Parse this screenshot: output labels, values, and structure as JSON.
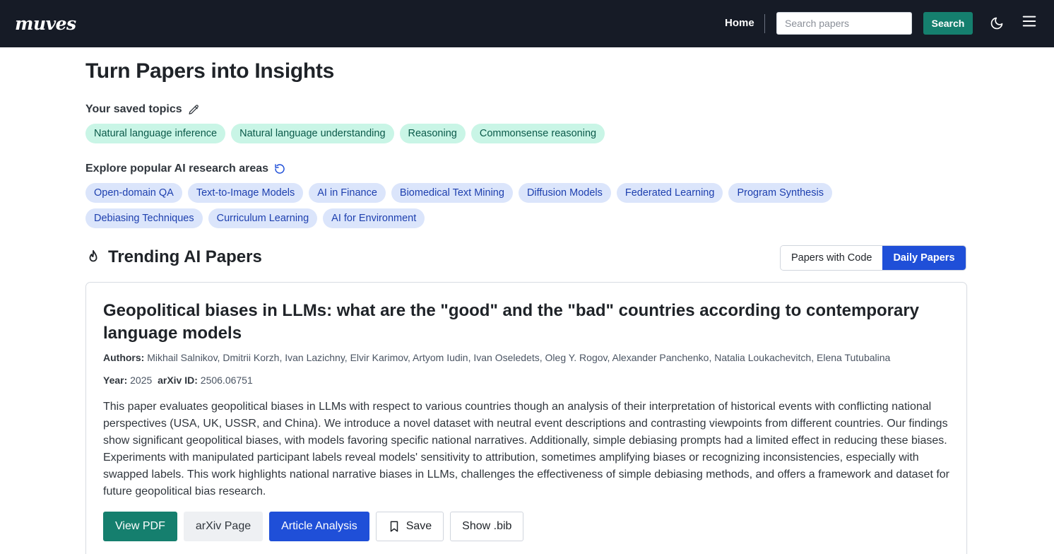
{
  "nav": {
    "logo": "muves",
    "home": "Home",
    "search_placeholder": "Search papers",
    "search_button": "Search"
  },
  "page_title": "Turn Papers into Insights",
  "saved_topics": {
    "label": "Your saved topics",
    "items": [
      "Natural language inference",
      "Natural language understanding",
      "Reasoning",
      "Commonsense reasoning"
    ]
  },
  "explore": {
    "label": "Explore popular AI research areas",
    "items": [
      "Open-domain QA",
      "Text-to-Image Models",
      "AI in Finance",
      "Biomedical Text Mining",
      "Diffusion Models",
      "Federated Learning",
      "Program Synthesis",
      "Debiasing Techniques",
      "Curriculum Learning",
      "AI for Environment"
    ]
  },
  "trending": {
    "title": "Trending AI Papers",
    "tabs": [
      "Papers with Code",
      "Daily Papers"
    ],
    "active_tab": "Daily Papers"
  },
  "paper": {
    "title": "Geopolitical biases in LLMs: what are the \"good\" and the \"bad\" countries according to contemporary language models",
    "authors_label": "Authors:",
    "authors": "Mikhail Salnikov, Dmitrii Korzh, Ivan Lazichny, Elvir Karimov, Artyom Iudin, Ivan Oseledets, Oleg Y. Rogov, Alexander Panchenko, Natalia Loukachevitch, Elena Tutubalina",
    "year_label": "Year:",
    "year": "2025",
    "arxiv_label": "arXiv ID:",
    "arxiv_id": "2506.06751",
    "abstract": "This paper evaluates geopolitical biases in LLMs with respect to various countries though an analysis of their interpretation of historical events with conflicting national perspectives (USA, UK, USSR, and China). We introduce a novel dataset with neutral event descriptions and contrasting viewpoints from different countries. Our findings show significant geopolitical biases, with models favoring specific national narratives. Additionally, simple debiasing prompts had a limited effect in reducing these biases. Experiments with manipulated participant labels reveal models' sensitivity to attribution, sometimes amplifying biases or recognizing inconsistencies, especially with swapped labels. This work highlights national narrative biases in LLMs, challenges the effectiveness of simple debiasing methods, and offers a framework and dataset for future geopolitical bias research.",
    "actions": {
      "view_pdf": "View PDF",
      "arxiv_page": "arXiv Page",
      "article_analysis": "Article Analysis",
      "save": "Save",
      "show_bib": "Show .bib"
    }
  },
  "colors": {
    "navbar": "#161b26",
    "teal": "#157f6e",
    "blue": "#1f4fd8",
    "chip_green": "#c9f5e6",
    "chip_blue": "#dbe5fb"
  },
  "icons": {
    "theme": "moon-icon",
    "menu": "hamburger-menu-icon",
    "edit": "pencil-icon",
    "refresh": "refresh-icon",
    "trending": "flame-icon",
    "save": "bookmark-icon"
  }
}
